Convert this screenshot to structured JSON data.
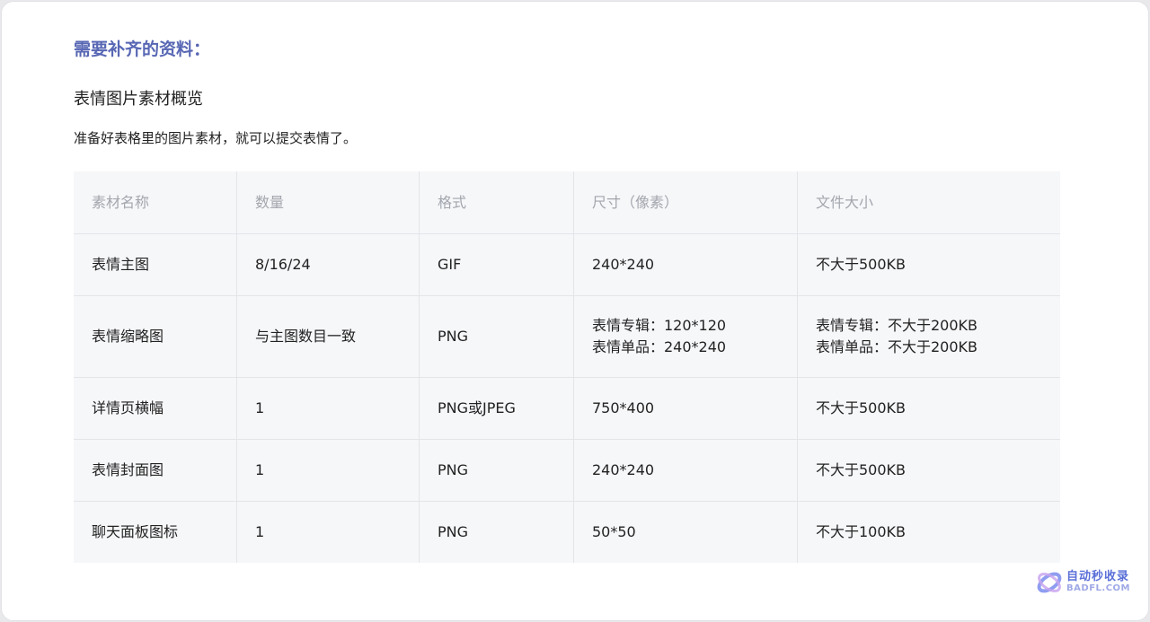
{
  "section_title": "需要补齐的资料：",
  "subheading": "表情图片素材概览",
  "description": "准备好表格里的图片素材，就可以提交表情了。",
  "table": {
    "headers": [
      "素材名称",
      "数量",
      "格式",
      "尺寸（像素）",
      "文件大小"
    ],
    "rows": [
      {
        "name": "表情主图",
        "count": "8/16/24",
        "format": "GIF",
        "size": [
          "240*240"
        ],
        "filesize": [
          "不大于500KB"
        ]
      },
      {
        "name": "表情缩略图",
        "count": "与主图数目一致",
        "format": "PNG",
        "size": [
          "表情专辑：120*120",
          "表情单品：240*240"
        ],
        "filesize": [
          "表情专辑：不大于200KB",
          "表情单品：不大于200KB"
        ]
      },
      {
        "name": "详情页横幅",
        "count": "1",
        "format": "PNG或JPEG",
        "size": [
          "750*400"
        ],
        "filesize": [
          "不大于500KB"
        ]
      },
      {
        "name": "表情封面图",
        "count": "1",
        "format": "PNG",
        "size": [
          "240*240"
        ],
        "filesize": [
          "不大于500KB"
        ]
      },
      {
        "name": "聊天面板图标",
        "count": "1",
        "format": "PNG",
        "size": [
          "50*50"
        ],
        "filesize": [
          "不大于100KB"
        ]
      }
    ]
  },
  "watermark": {
    "icon": "swirl-logo-icon",
    "text_cn": "自动秒收录",
    "text_en": "BADFL.COM"
  },
  "colors": {
    "accent_title": "#5867b4",
    "table_background": "#f6f7f9",
    "header_text": "#a3a6ad"
  }
}
